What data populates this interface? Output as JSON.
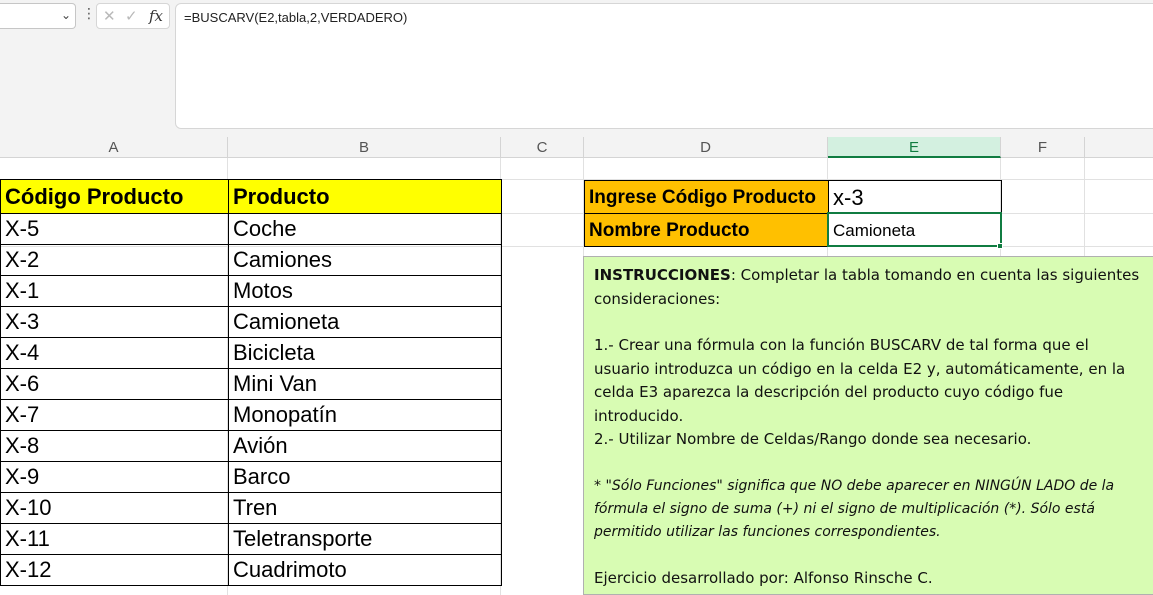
{
  "formula_bar": {
    "name_box_value": "",
    "cancel_icon": "cancel-icon",
    "enter_icon": "check-icon",
    "fx_label": "fx",
    "formula": "=BUSCARV(E2,tabla,2,VERDADERO)"
  },
  "columns": [
    "A",
    "B",
    "C",
    "D",
    "E",
    "F"
  ],
  "table": {
    "header_code": "Código Producto",
    "header_product": "Producto",
    "rows": [
      {
        "code": "X-5",
        "product": "Coche"
      },
      {
        "code": "X-2",
        "product": "Camiones"
      },
      {
        "code": "X-1",
        "product": "Motos"
      },
      {
        "code": "X-3",
        "product": "Camioneta"
      },
      {
        "code": "X-4",
        "product": "Bicicleta"
      },
      {
        "code": "X-6",
        "product": "Mini Van"
      },
      {
        "code": "X-7",
        "product": "Monopatín"
      },
      {
        "code": "X-8",
        "product": "Avión"
      },
      {
        "code": "X-9",
        "product": "Barco"
      },
      {
        "code": "X-10",
        "product": "Tren"
      },
      {
        "code": "X-11",
        "product": "Teletransporte"
      },
      {
        "code": "X-12",
        "product": "Cuadrimoto"
      }
    ]
  },
  "lookup": {
    "input_label": "Ingrese Código Producto",
    "input_value": "x-3",
    "result_label": "Nombre Producto",
    "result_value": "Camioneta"
  },
  "instructions": {
    "title": "INSTRUCCIONES",
    "intro": ": Completar la tabla tomando en cuenta las siguientes consideraciones:",
    "step1": "1.- Crear una fórmula con la función BUSCARV de tal forma que el usuario introduzca un código en la celda E2 y, automáticamente, en la celda E3 aparezca la descripción del producto cuyo código fue introducido.",
    "step2": "2.- Utilizar Nombre de Celdas/Rango donde sea necesario.",
    "note": "* \"Sólo Funciones\" significa que NO debe aparecer en NINGÚN LADO de la fórmula el signo de suma (+) ni el signo de multiplicación (*). Sólo está permitido utilizar las funciones correspondientes.",
    "author": "Ejercicio desarrollado por: Alfonso Rinsche C."
  },
  "colors": {
    "header_fill": "#ffff00",
    "label_fill": "#ffc000",
    "note_fill": "#d8fcb3",
    "selection": "#107c41"
  }
}
